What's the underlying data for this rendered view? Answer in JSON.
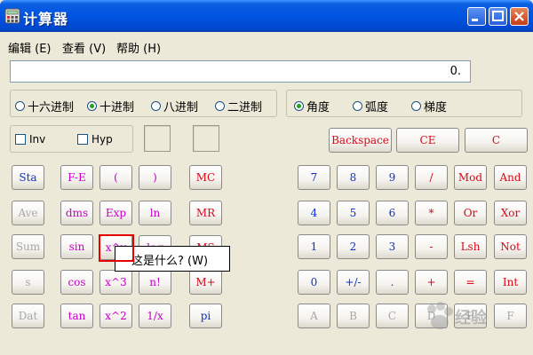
{
  "window": {
    "title": "计算器"
  },
  "menu": [
    "编辑 (E)",
    "查看 (V)",
    "帮助 (H)"
  ],
  "display": {
    "value": "0."
  },
  "radix": [
    {
      "label": "十六进制",
      "selected": false
    },
    {
      "label": "十进制",
      "selected": true
    },
    {
      "label": "八进制",
      "selected": false
    },
    {
      "label": "二进制",
      "selected": false
    }
  ],
  "angle_units": [
    {
      "label": "角度",
      "selected": true
    },
    {
      "label": "弧度",
      "selected": false
    },
    {
      "label": "梯度",
      "selected": false
    }
  ],
  "checks": {
    "inv": "Inv",
    "hyp": "Hyp"
  },
  "keys": {
    "backspace": "Backspace",
    "ce": "CE",
    "c": "C",
    "sta": "Sta",
    "ave": "Ave",
    "sum": "Sum",
    "s": "s",
    "dat": "Dat",
    "fe": "F-E",
    "dms": "dms",
    "sin": "sin",
    "cos": "cos",
    "tan": "tan",
    "lparen": "(",
    "rparen": ")",
    "exp": "Exp",
    "ln": "ln",
    "xy": "x^y",
    "log": "log",
    "x3": "x^3",
    "nfact": "n!",
    "x2": "x^2",
    "inv": "1/x",
    "mc": "MC",
    "mr": "MR",
    "ms": "MS",
    "mplus": "M+",
    "pi": "pi",
    "d7": "7",
    "d8": "8",
    "d9": "9",
    "div": "/",
    "mod": "Mod",
    "and": "And",
    "d4": "4",
    "d5": "5",
    "d6": "6",
    "mul": "*",
    "or": "Or",
    "xor": "Xor",
    "d1": "1",
    "d2": "2",
    "d3": "3",
    "sub": "-",
    "lsh": "Lsh",
    "not": "Not",
    "d0": "0",
    "sign": "+/-",
    "dot": ".",
    "add": "+",
    "eq": "=",
    "int": "Int",
    "a": "A",
    "b": "B",
    "cc": "C",
    "d": "D",
    "e": "E",
    "f": "F"
  },
  "tooltip": "这是什么? (W)",
  "watermark": "经验"
}
